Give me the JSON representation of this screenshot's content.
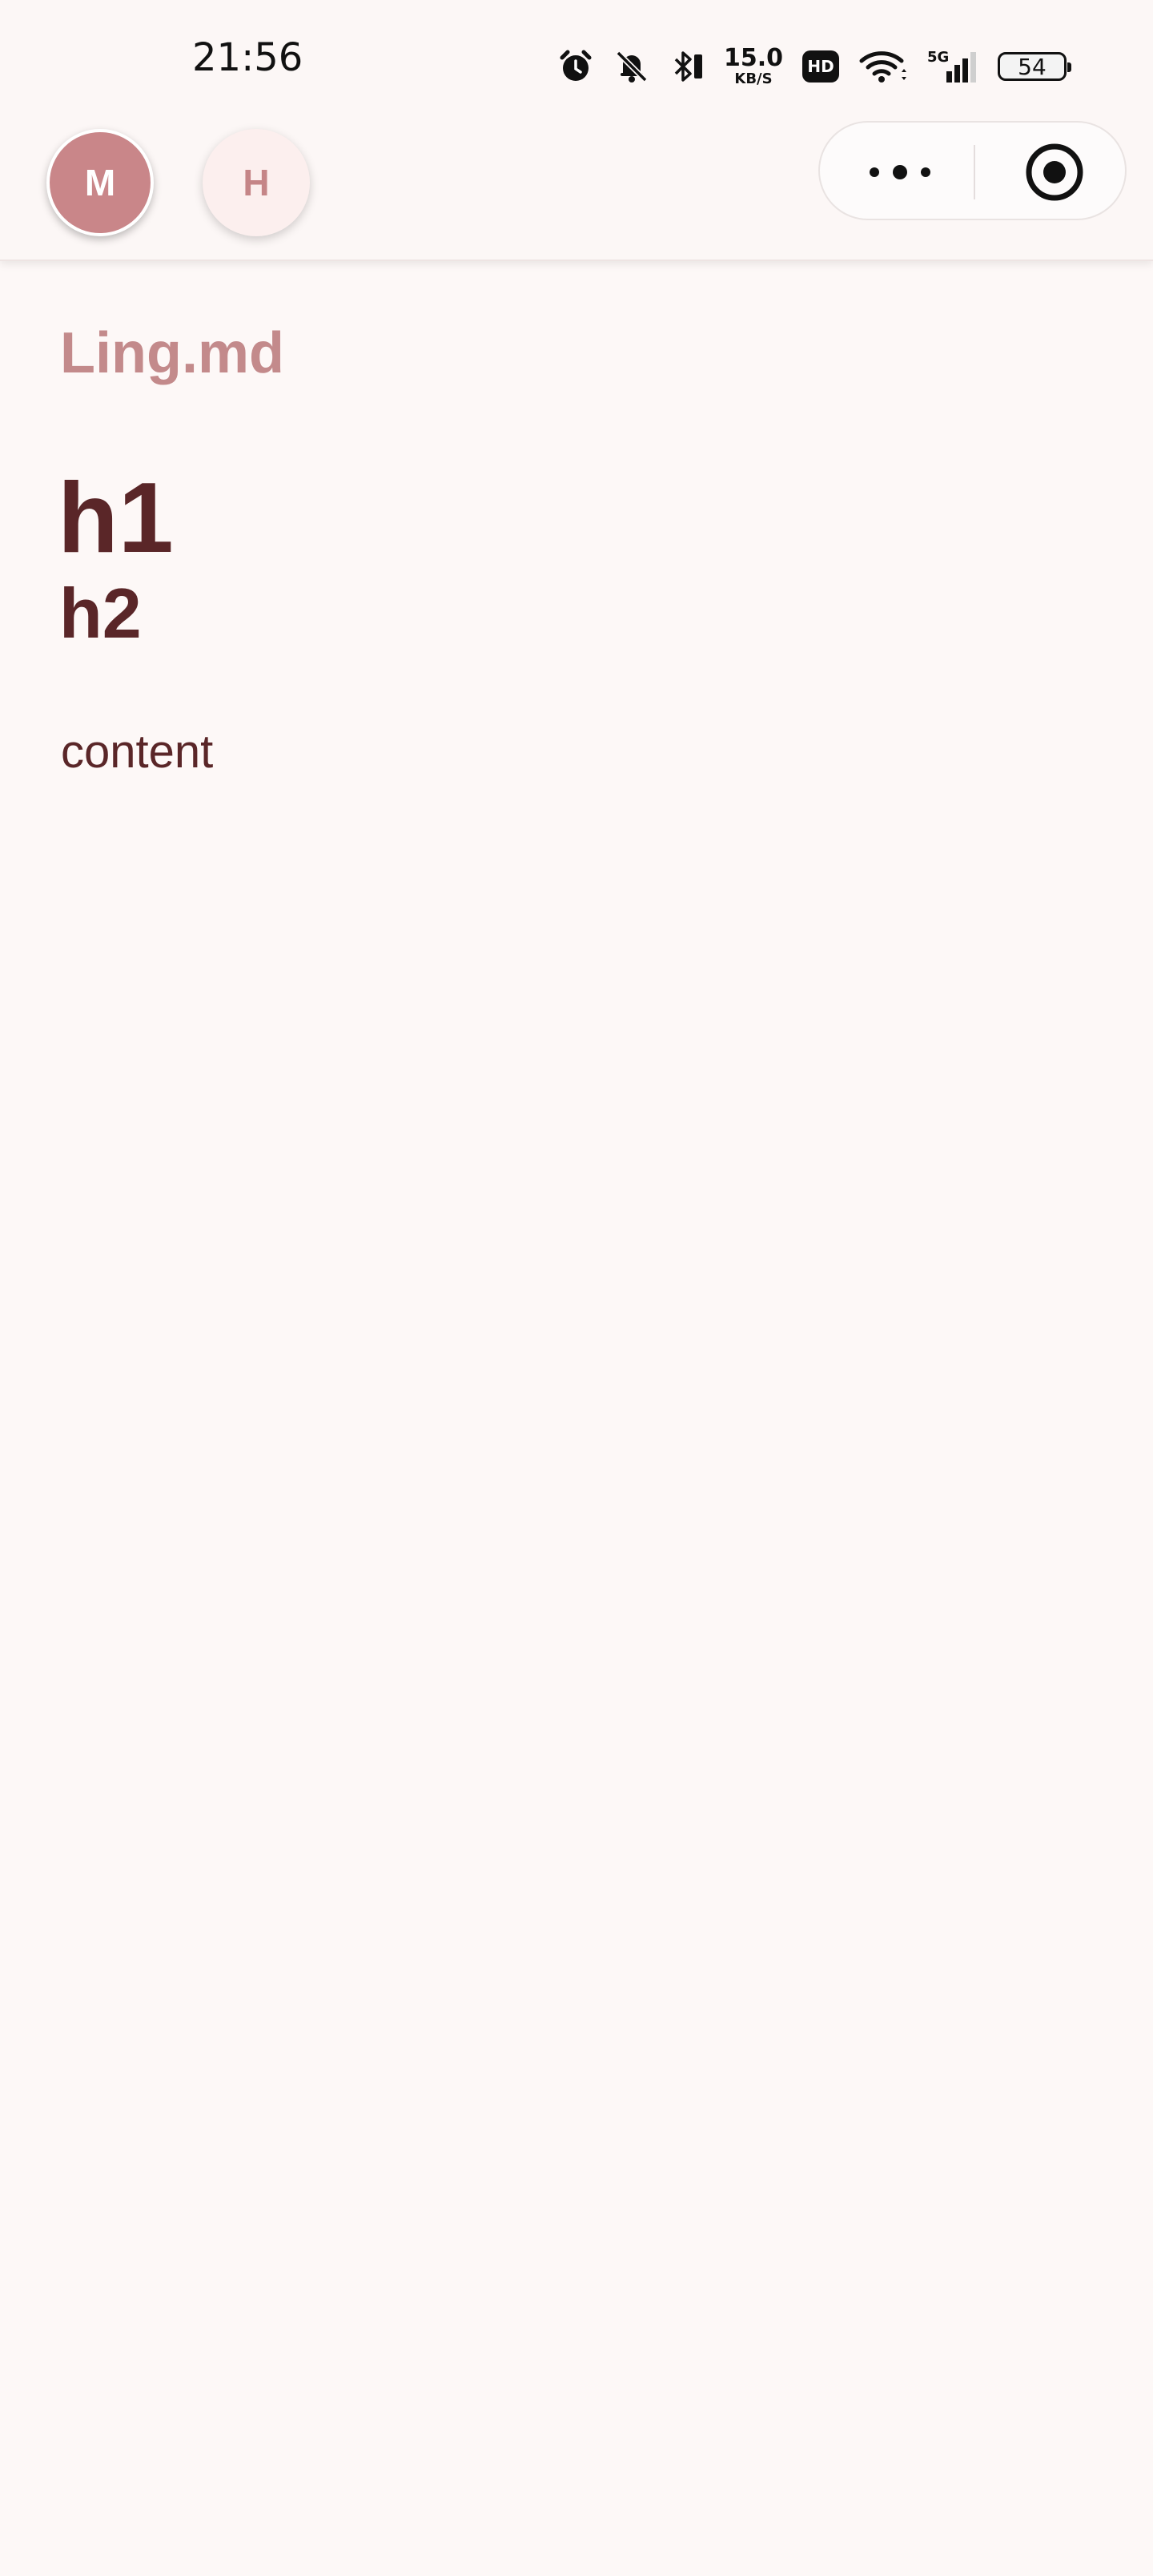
{
  "status_bar": {
    "time": "21:56",
    "network_speed_value": "15.0",
    "network_speed_unit": "KB/S",
    "hd_label": "HD",
    "cellular_label": "5G",
    "battery_level": "54",
    "icons": [
      "alarm-icon",
      "bell-off-icon",
      "bluetooth-icon",
      "wifi-icon",
      "signal-icon",
      "battery-icon"
    ]
  },
  "header": {
    "avatars": [
      {
        "letter": "M",
        "state": "active"
      },
      {
        "letter": "H",
        "state": "inactive"
      }
    ],
    "capsule": {
      "more_icon": "more-dots-icon",
      "close_icon": "target-circle-icon"
    }
  },
  "document": {
    "title": "Ling.md",
    "h1": "h1",
    "h2": "h2",
    "content": "content"
  },
  "colors": {
    "background": "#fdf8f7",
    "accent": "#c98689",
    "title": "#c38a8b",
    "text": "#5a2628"
  }
}
